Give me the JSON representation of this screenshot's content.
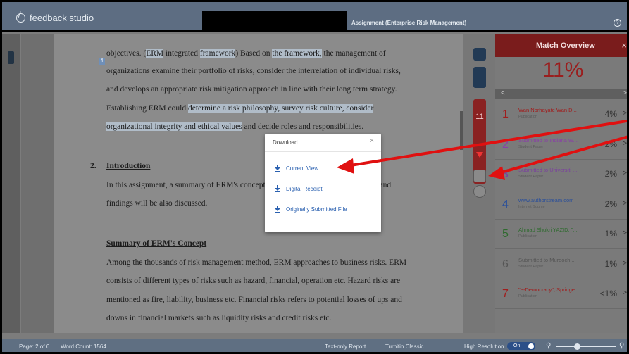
{
  "header": {
    "brand": "feedback studio",
    "assignment_title": "Assignment (Enterprise Risk Management)",
    "help_icon": "?"
  },
  "document": {
    "lines": [
      "objectives. (ERM integrated framework) Based on the framework, the management of",
      "organizations examine their portfolio of risks, consider the interrelation of individual risks,",
      "and develops an appropriate risk mitigation approach in line with their long term strategy.",
      "Establishing ERM could determine a risk philosophy, survey risk culture, consider",
      "organizational integrity and ethical values and decide roles and responsibilities.",
      "2.",
      "Introduction",
      "In this assignment, a summary of ERM's concept, the roles of the board of directors and",
      "findings will be also discussed.",
      "Summary of ERM's Concept",
      "Among the thousands of risk management method, ERM approaches to business risks. ERM",
      "consists of different types of risks such as hazard, financial, operation etc. Hazard risks are",
      "mentioned as fire, liability, business etc. Financial risks refers to potential losses of ups and",
      "downs in financial markets such as liquidity risks and credit risks etc."
    ],
    "match_marker": "4"
  },
  "modal": {
    "title": "Download",
    "close": "×",
    "options": [
      "Current View",
      "Digital Receipt",
      "Originally Submitted File"
    ]
  },
  "toolbar": {
    "similarity_count": "11"
  },
  "match_overview": {
    "title": "Match Overview",
    "close": "×",
    "percent": "11%",
    "nav_prev": "<",
    "nav_next": ">",
    "sources": [
      {
        "num": "1",
        "title": "Wan Norhayate Wan D...",
        "type": "Publication",
        "pct": "4%",
        "color": "#a11d1d"
      },
      {
        "num": "2",
        "title": "Submitted to Indiana W...",
        "type": "Student Paper",
        "pct": "2%",
        "color": "#8a3ea8"
      },
      {
        "num": "3",
        "title": "Submitted to Universiti ...",
        "type": "Student Paper",
        "pct": "2%",
        "color": "#7a3ea0"
      },
      {
        "num": "4",
        "title": "www.authorstream.com",
        "type": "Internet Source",
        "pct": "2%",
        "color": "#2a4f9a"
      },
      {
        "num": "5",
        "title": "Ahmad Shukri YAZID. \"...",
        "type": "Publication",
        "pct": "1%",
        "color": "#2f6b2f"
      },
      {
        "num": "6",
        "title": "Submitted to Murdoch ...",
        "type": "Student Paper",
        "pct": "1%",
        "color": "#555555"
      },
      {
        "num": "7",
        "title": "\"e-Democracy\", Springe...",
        "type": "Publication",
        "pct": "<1%",
        "color": "#a11d1d"
      }
    ],
    "chevron": ">"
  },
  "footer": {
    "page": "Page: 2 of 6",
    "word_count": "Word Count: 1564",
    "text_only": "Text-only Report",
    "classic": "Turnitin Classic",
    "high_res": "High Resolution",
    "toggle": "On"
  }
}
